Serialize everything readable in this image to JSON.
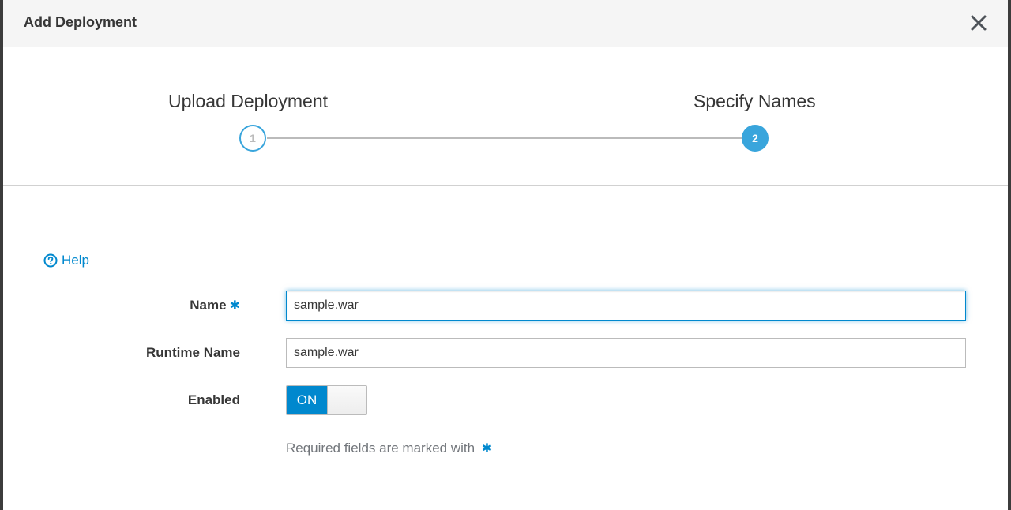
{
  "modal": {
    "title": "Add Deployment",
    "close_icon": "close-icon"
  },
  "wizard": {
    "steps": [
      {
        "label": "Upload Deployment",
        "number": "1",
        "state": "completed"
      },
      {
        "label": "Specify Names",
        "number": "2",
        "state": "active"
      }
    ]
  },
  "help": {
    "label": "Help",
    "icon": "question-circle-icon"
  },
  "form": {
    "name_label": "Name",
    "name_value": "sample.war",
    "runtime_name_label": "Runtime Name",
    "runtime_name_value": "sample.war",
    "enabled_label": "Enabled",
    "enabled_toggle_label": "ON",
    "required_marker": "✱",
    "required_note": "Required fields are marked with"
  },
  "colors": {
    "accent": "#0088ce",
    "step_blue": "#39a5dc"
  }
}
